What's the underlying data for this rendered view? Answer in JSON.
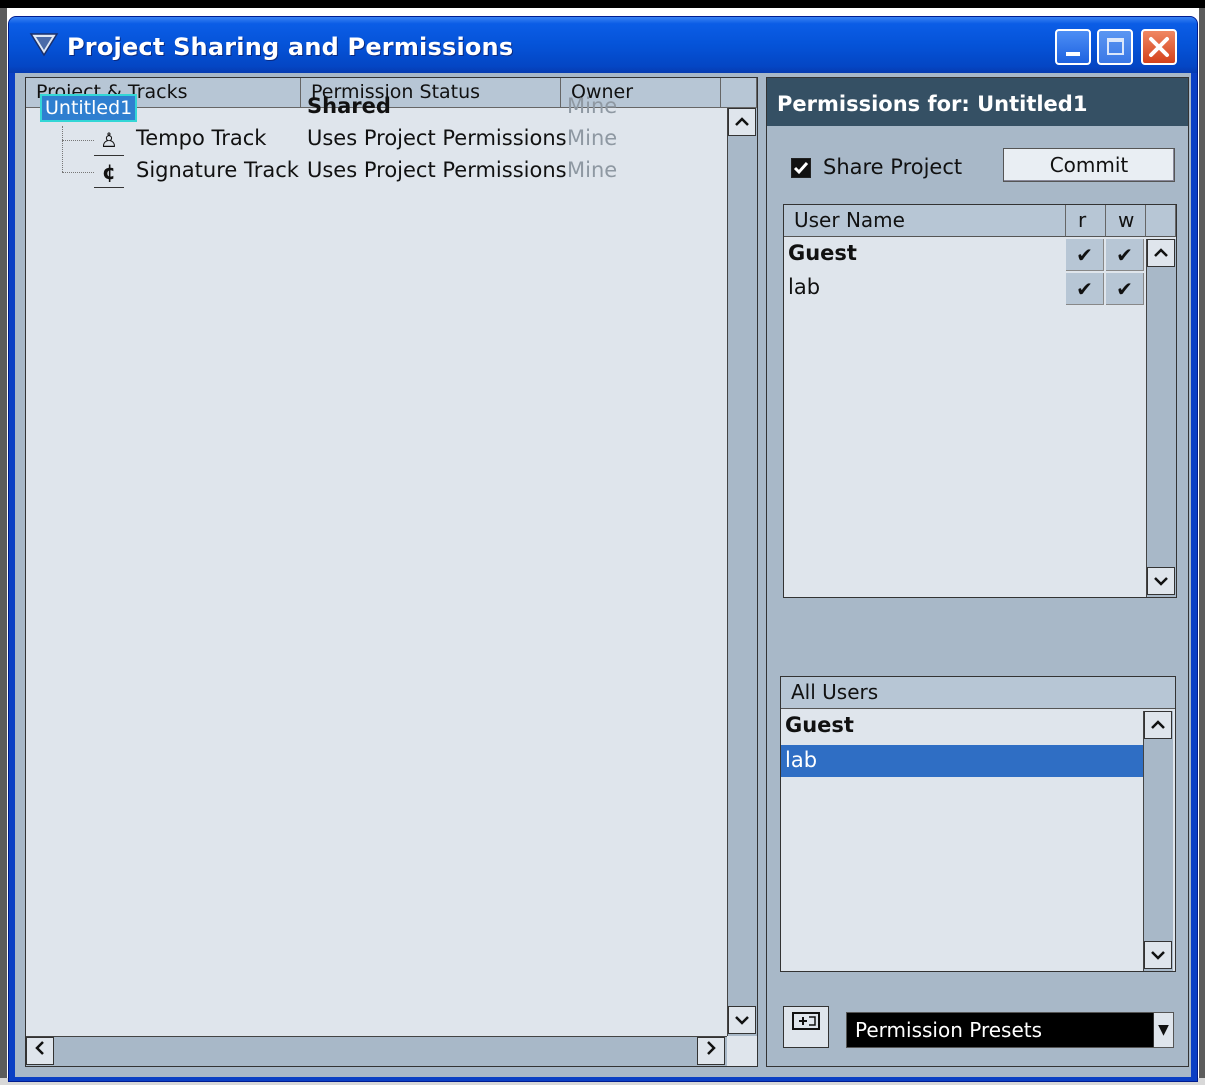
{
  "window": {
    "title": "Project Sharing and Permissions"
  },
  "tree": {
    "columns": [
      "Project & Tracks",
      "Permission Status",
      "Owner"
    ],
    "project": {
      "name": "Untitled1",
      "status": "Shared",
      "owner": "Mine"
    },
    "tracks": [
      {
        "name": "Tempo Track",
        "icon": "metronome-icon",
        "glyph": "♙",
        "status": "Uses Project Permissions",
        "owner": "Mine"
      },
      {
        "name": "Signature Track",
        "icon": "signature-icon",
        "glyph": "¢",
        "status": "Uses Project Permissions",
        "owner": "Mine"
      }
    ]
  },
  "permissions": {
    "header": "Permissions for: Untitled1",
    "share_label": "Share Project",
    "share_checked": true,
    "commit_label": "Commit",
    "grid_columns": [
      "User Name",
      "r",
      "w"
    ],
    "users": [
      {
        "name": "Guest",
        "r": "✔",
        "w": "✔"
      },
      {
        "name": "lab",
        "r": "✔",
        "w": "✔"
      }
    ]
  },
  "all_users": {
    "header": "All Users",
    "items": [
      "Guest",
      "lab"
    ],
    "selected": "lab"
  },
  "presets": {
    "label": "Permission Presets"
  },
  "colors": {
    "title_bar": "#0553d8",
    "header_dark": "#355064",
    "selection": "#2f6ec4",
    "panel_bg": "#dfe5ec",
    "frame_bg": "#a8b8c8"
  }
}
